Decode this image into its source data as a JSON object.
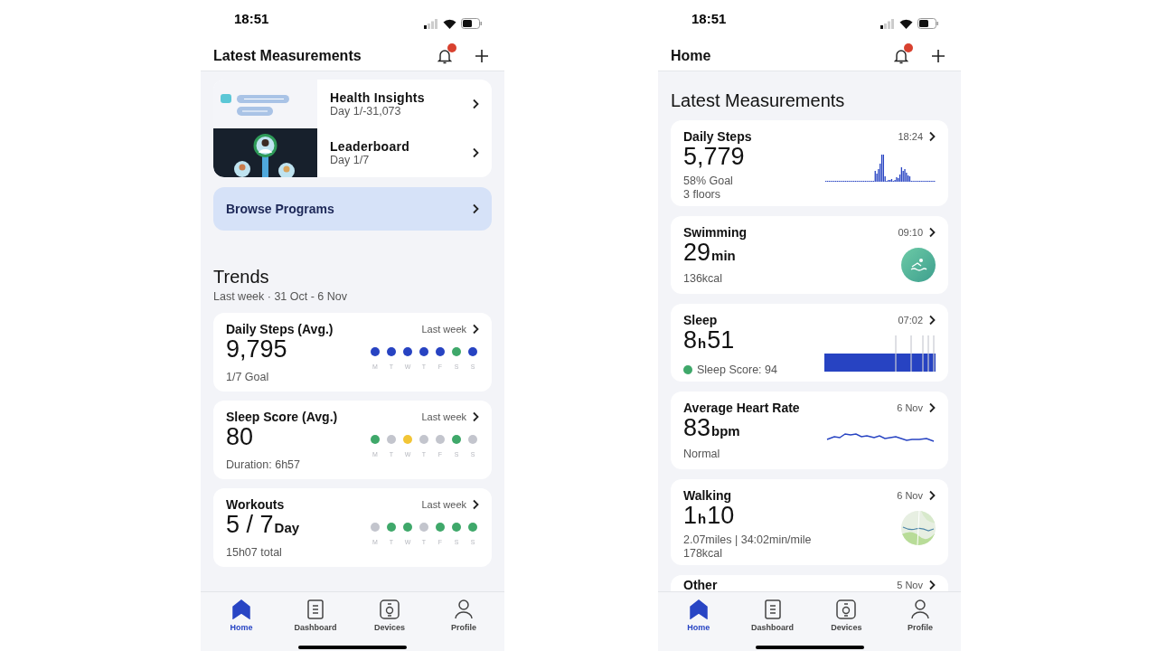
{
  "screens": [
    {
      "status": {
        "time": "18:51"
      },
      "header": {
        "title": "Latest Measurements",
        "notification": true
      },
      "programs": [
        {
          "kind": "chat",
          "title": "Health Insights",
          "subtitle": "Day 1/-31,073"
        },
        {
          "kind": "leaderboard",
          "title": "Leaderboard",
          "subtitle": "Day 1/7"
        }
      ],
      "browse": {
        "label": "Browse Programs"
      },
      "trends": {
        "title": "Trends",
        "subtitle": "Last week · 31 Oct - 6 Nov",
        "cards": [
          {
            "title": "Daily Steps (Avg.)",
            "period": "Last week",
            "value": [
              {
                "kind": "big",
                "text": "9,795"
              }
            ],
            "note": "1/7 Goal",
            "days": [
              {
                "label": "M",
                "color": "#2743c2"
              },
              {
                "label": "T",
                "color": "#2743c2"
              },
              {
                "label": "W",
                "color": "#2743c2"
              },
              {
                "label": "T",
                "color": "#2743c2"
              },
              {
                "label": "F",
                "color": "#2743c2"
              },
              {
                "label": "S",
                "color": "#3fa86a"
              },
              {
                "label": "S",
                "color": "#2743c2"
              }
            ]
          },
          {
            "title": "Sleep Score (Avg.)",
            "period": "Last week",
            "value": [
              {
                "kind": "big",
                "text": "80"
              }
            ],
            "note": "Duration: 6h57",
            "days": [
              {
                "label": "M",
                "color": "#3fa86a"
              },
              {
                "label": "T",
                "color": "#c3c5cd"
              },
              {
                "label": "W",
                "color": "#f2c536"
              },
              {
                "label": "T",
                "color": "#c3c5cd"
              },
              {
                "label": "F",
                "color": "#c3c5cd"
              },
              {
                "label": "S",
                "color": "#3fa86a"
              },
              {
                "label": "S",
                "color": "#c3c5cd"
              }
            ]
          },
          {
            "title": "Workouts",
            "period": "Last week",
            "value": [
              {
                "kind": "big",
                "text": "5 / 7"
              },
              {
                "kind": "unit",
                "text": "Day"
              }
            ],
            "note": "15h07 total",
            "days": [
              {
                "label": "M",
                "color": "#c3c5cd"
              },
              {
                "label": "T",
                "color": "#3fa86a"
              },
              {
                "label": "W",
                "color": "#3fa86a"
              },
              {
                "label": "T",
                "color": "#c3c5cd"
              },
              {
                "label": "F",
                "color": "#3fa86a"
              },
              {
                "label": "S",
                "color": "#3fa86a"
              },
              {
                "label": "S",
                "color": "#3fa86a"
              }
            ]
          }
        ]
      },
      "nav": [
        {
          "kind": "home",
          "label": "Home",
          "selected": true
        },
        {
          "kind": "dashboard",
          "label": "Dashboard",
          "selected": false
        },
        {
          "kind": "devices",
          "label": "Devices",
          "selected": false
        },
        {
          "kind": "profile",
          "label": "Profile",
          "selected": false
        }
      ]
    },
    {
      "status": {
        "time": "18:51"
      },
      "header": {
        "title": "Home",
        "notification": true
      },
      "section_title": "Latest Measurements",
      "measurements": [
        {
          "kind": "steps",
          "title": "Daily Steps",
          "time": "18:24",
          "value": [
            {
              "kind": "big",
              "text": "5,779"
            }
          ],
          "notes": [
            "58% Goal",
            "3 floors"
          ]
        },
        {
          "kind": "swim",
          "title": "Swimming",
          "time": "09:10",
          "value": [
            {
              "kind": "big",
              "text": "29"
            },
            {
              "kind": "unit",
              "text": "min"
            }
          ],
          "notes": [
            "136kcal"
          ]
        },
        {
          "kind": "sleep",
          "title": "Sleep",
          "time": "07:02",
          "value": [
            {
              "kind": "big",
              "text": "8"
            },
            {
              "kind": "unit",
              "text": "h"
            },
            {
              "kind": "big",
              "text": "51"
            }
          ],
          "score": {
            "text": "Sleep Score: 94",
            "color": "#3fa86a"
          }
        },
        {
          "kind": "heart",
          "title": "Average Heart Rate",
          "time": "6 Nov",
          "value": [
            {
              "kind": "big",
              "text": "83"
            },
            {
              "kind": "unit",
              "text": "bpm"
            }
          ],
          "notes": [
            "Normal"
          ]
        },
        {
          "kind": "map",
          "title": "Walking",
          "time": "6 Nov",
          "value": [
            {
              "kind": "big",
              "text": "1"
            },
            {
              "kind": "unit",
              "text": "h"
            },
            {
              "kind": "big",
              "text": "10"
            }
          ],
          "notes": [
            "2.07miles | 34:02min/mile",
            "178kcal"
          ]
        },
        {
          "kind": "partial",
          "title": "Other",
          "time": "5 Nov"
        }
      ],
      "nav": [
        {
          "kind": "home",
          "label": "Home",
          "selected": true
        },
        {
          "kind": "dashboard",
          "label": "Dashboard",
          "selected": false
        },
        {
          "kind": "devices",
          "label": "Devices",
          "selected": false
        },
        {
          "kind": "profile",
          "label": "Profile",
          "selected": false
        }
      ]
    }
  ]
}
